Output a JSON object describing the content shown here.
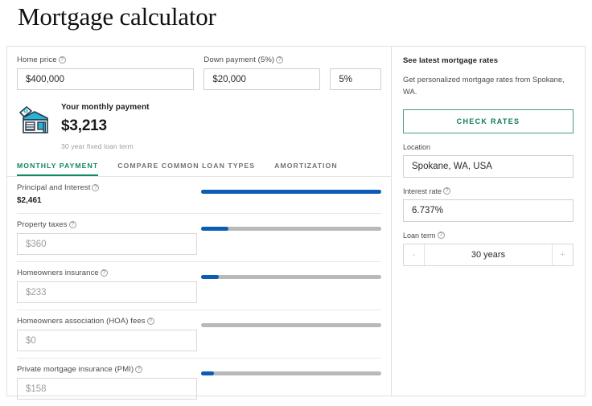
{
  "page": {
    "title": "Mortgage calculator"
  },
  "colors": {
    "accent_green": "#0f8a5f",
    "slider_blue": "#0b5cb5",
    "slider_track": "#b7b9bb",
    "button_border_green": "#4e9b7d"
  },
  "top_inputs": {
    "home_price": {
      "label": "Home price",
      "help": "?",
      "value": "$400,000"
    },
    "down_payment": {
      "label": "Down payment (5%)",
      "help": "?",
      "value": "$20,000"
    },
    "down_payment_percent": {
      "value": "5%"
    }
  },
  "summary": {
    "icon": "house-price-tag-icon",
    "title": "Your monthly payment",
    "amount": "$3,213",
    "subtitle": "30 year fixed loan term"
  },
  "tabs": [
    {
      "label": "MONTHLY PAYMENT",
      "active": true
    },
    {
      "label": "COMPARE COMMON LOAN TYPES",
      "active": false
    },
    {
      "label": "AMORTIZATION",
      "active": false
    }
  ],
  "breakdown": [
    {
      "name": "principal-and-interest",
      "label": "Principal and Interest",
      "help": "?",
      "value": "$2,461",
      "editable": false,
      "slider_percent": 100
    },
    {
      "name": "property-taxes",
      "label": "Property taxes",
      "help": "?",
      "value": "$360",
      "editable": true,
      "slider_percent": 15
    },
    {
      "name": "homeowners-insurance",
      "label": "Homeowners insurance",
      "help": "?",
      "value": "$233",
      "editable": true,
      "slider_percent": 10
    },
    {
      "name": "hoa-fees",
      "label": "Homeowners association (HOA) fees",
      "help": "?",
      "value": "$0",
      "editable": true,
      "slider_percent": 0
    },
    {
      "name": "private-mortgage-insurance",
      "label": "Private mortgage insurance (PMI)",
      "help": "?",
      "value": "$158",
      "editable": true,
      "slider_percent": 7
    }
  ],
  "sidebar": {
    "title": "See latest mortgage rates",
    "description": "Get personalized mortgage rates from Spokane, WA.",
    "check_rates_label": "CHECK RATES",
    "location": {
      "label": "Location",
      "value": "Spokane, WA, USA"
    },
    "interest_rate": {
      "label": "Interest rate",
      "help": "?",
      "value": "6.737%"
    },
    "loan_term": {
      "label": "Loan term",
      "help": "?",
      "value": "30 years",
      "decrement_label": "-",
      "increment_label": "+"
    }
  }
}
